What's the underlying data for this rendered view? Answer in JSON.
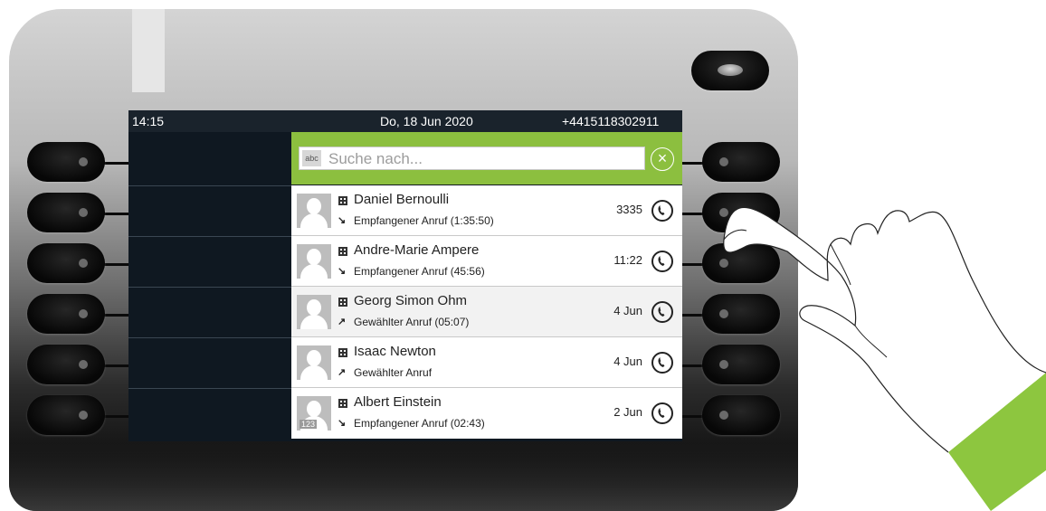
{
  "statusbar": {
    "time": "14:15",
    "date": "Do, 18 Jun 2020",
    "number": "+4415118302911"
  },
  "search": {
    "mode_label": "abc",
    "placeholder": "Suche nach..."
  },
  "calls": [
    {
      "name": "Daniel Bernoulli",
      "detail": "Empfangener Anruf (1:35:50)",
      "meta": "3335",
      "direction": "incoming"
    },
    {
      "name": "Andre-Marie Ampere",
      "detail": "Empfangener Anruf (45:56)",
      "meta": "11:22",
      "direction": "incoming"
    },
    {
      "name": "Georg Simon Ohm",
      "detail": "Gewählter Anruf (05:07)",
      "meta": "4 Jun",
      "direction": "outgoing"
    },
    {
      "name": "Isaac Newton",
      "detail": "Gewählter Anruf",
      "meta": "4 Jun",
      "direction": "outgoing"
    },
    {
      "name": "Albert Einstein",
      "detail": "Empfangener Anruf (02:43)",
      "meta": "2 Jun",
      "direction": "incoming",
      "avatar_badge": "123"
    }
  ],
  "icons": {
    "incoming_arrow": "↘",
    "outgoing_arrow": "↗",
    "clear": "×"
  },
  "colors": {
    "accent": "#8cbf3f",
    "screen_bg": "#0f1821",
    "hand_sleeve": "#8dc63f"
  }
}
